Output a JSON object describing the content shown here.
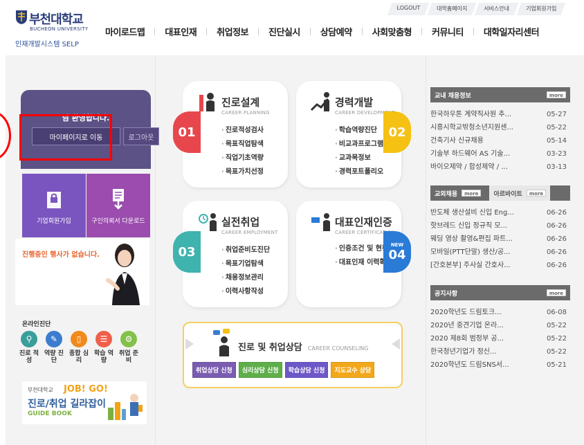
{
  "logo": {
    "name": "부천대학교",
    "en": "BUCHEON UNIVERSITY",
    "subtitle": "인재개발시스템 SELP"
  },
  "util_nav": [
    "LOGOUT",
    "대학홈페이지",
    "서비스안내",
    "기업회원가입"
  ],
  "gnb": [
    "마이로드맵",
    "대표인재",
    "취업정보",
    "진단실시",
    "상담예약",
    "사회맞춤형",
    "커뮤니티",
    "대학일자리센터"
  ],
  "login": {
    "message": "님 환영합니다.",
    "mypage_label": "마이페이지로 이동",
    "logout_label": "로그아웃"
  },
  "tiles": {
    "company_join": "기업회원가입",
    "job_request": "구인의뢰서 다운로드"
  },
  "event": {
    "text": "진행중인 행사가 없습니다."
  },
  "diagnosis": {
    "title": "온라인진단",
    "items": [
      {
        "label": "진로 적성",
        "color": "#3a9e9b"
      },
      {
        "label": "역량 진단",
        "color": "#3b7ccf"
      },
      {
        "label": "종합 심리",
        "color": "#f08a1c"
      },
      {
        "label": "학습 역량",
        "color": "#ef5f4a"
      },
      {
        "label": "취업 준비",
        "color": "#83c14a"
      }
    ]
  },
  "guide": {
    "small": "부천대학교",
    "jobgo": "JOB! GO!",
    "title": "진로/취업 길라잡이",
    "book": "GUIDE BOOK"
  },
  "cards": {
    "career_plan": {
      "title": "진로설계",
      "en": "CAREER PLANNING",
      "num": "01",
      "color": "#e7474c",
      "items": [
        "진로적성검사",
        "목표직업탐색",
        "직업기초역량",
        "목표가치선정"
      ]
    },
    "career_dev": {
      "title": "경력개발",
      "en": "CAREER DEVELOPMENT",
      "num": "02",
      "color": "#f5c112",
      "items": [
        "학습역량진단",
        "비교과프로그램",
        "교과목정보",
        "경력포트폴리오"
      ]
    },
    "employment": {
      "title": "실전취업",
      "en": "CAREER EMPLOYMENT",
      "num": "03",
      "color": "#3fb3ad",
      "items": [
        "취업준비도진단",
        "목표기업탐색",
        "채용정보관리",
        "이력사항작성"
      ]
    },
    "certification": {
      "title": "대표인재인증",
      "en": "CAREER CERTIFICATION",
      "num": "04",
      "color": "#2a7bd6",
      "badge": "NEW",
      "items": [
        "인증조건 및 현황",
        "대표인재 이력확인서"
      ]
    }
  },
  "counsel": {
    "title": "진로 및 취업상담",
    "en": "CAREER COUNSELING",
    "buttons": [
      {
        "label": "취업상담 신청",
        "color": "#7a5cb0"
      },
      {
        "label": "심리상담 신청",
        "color": "#5fae4a"
      },
      {
        "label": "학습상담 신청",
        "color": "#6e58c8"
      },
      {
        "label": "지도교수 상담",
        "color": "#f3a81c"
      }
    ]
  },
  "boards": {
    "campus": {
      "title": "교내 채용정보",
      "more": "more",
      "items": [
        {
          "t": "한국하우톤 계약직사원 추...",
          "d": "05-27"
        },
        {
          "t": "시흥시학교밖청소년지원센...",
          "d": "05-22"
        },
        {
          "t": "건축기사 신규채용",
          "d": "05-14"
        },
        {
          "t": "기술부 하드웨어 AS 기술...",
          "d": "03-23"
        },
        {
          "t": "바이오제약 / 합성제약 / ...",
          "d": "03-13"
        }
      ]
    },
    "external": {
      "tab1": "교외채용",
      "tab2": "아르바이트",
      "more": "more",
      "items": [
        {
          "t": "반도체 생산설비 신입 Eng...",
          "d": "06-26"
        },
        {
          "t": "핫브레드 신입 정규직 모...",
          "d": "06-26"
        },
        {
          "t": "웨딩 영상 촬영&편집 파트...",
          "d": "06-26"
        },
        {
          "t": "모바일(PTT단말) 생산/공...",
          "d": "06-26"
        },
        {
          "t": "[간호본부] 주사실 간호사...",
          "d": "06-26"
        }
      ]
    },
    "notice": {
      "title": "공지사항",
      "more": "more",
      "items": [
        {
          "t": "2020학년도 드림토크...",
          "d": "06-08"
        },
        {
          "t": "2020년 중견기업 온라...",
          "d": "05-22"
        },
        {
          "t": "2020 제8회 범정부 공...",
          "d": "05-22"
        },
        {
          "t": "한국청년기업가 정신...",
          "d": "05-22"
        },
        {
          "t": "2020학년도 드림SNS서...",
          "d": "05-21"
        }
      ]
    }
  }
}
